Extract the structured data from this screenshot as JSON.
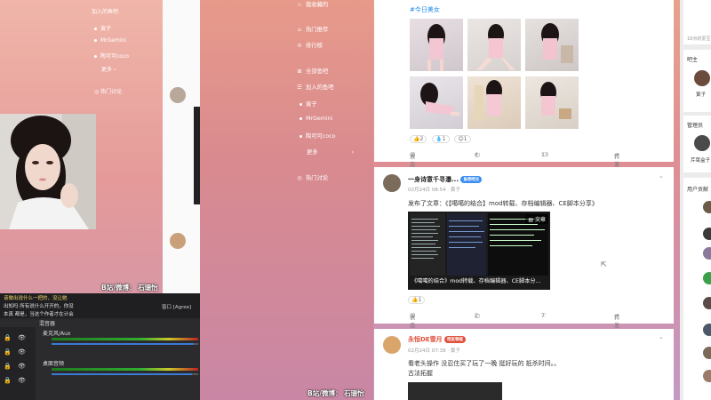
{
  "background_window": {
    "nav": [
      "加入的鱼吧",
      "寅子",
      "MrGemini",
      "陶可可coco",
      "更多",
      "热门讨论"
    ]
  },
  "obs": {
    "chat_lines": [
      "说我没有做，那我那，百话小哥",
      "eat的眼  就说我以讲一下发自己",
      "坦白说就，你不好的，到三年",
      "或者首接心用一做了完你能的",
      "这样的的二，就把从先出题，就自",
      "去是行的  日和日，从2年都到",
      "B站/微博：  石舔怡",
      "该做出说什么一把的，没让她",
      "出知吗  所有说什么开开的，你没",
      "本真  都是，当这个作者才在计会",
      "窗口    [Agree]"
    ],
    "mixer_title": "混音器",
    "source_mic": "麦克风/Aux",
    "source_desktop": "桌面音频",
    "db_ticks": [
      "-60",
      "-55",
      "-50",
      "-45",
      "-40",
      "-35",
      "-30",
      "-25",
      "-20",
      "-15",
      "-10",
      "-5",
      "0"
    ]
  },
  "nav": {
    "items": [
      {
        "label": "我收藏的",
        "icon": "star-icon"
      },
      {
        "label": "热门推荐",
        "icon": "home-icon"
      },
      {
        "label": "排行榜",
        "icon": "ranking-icon"
      },
      {
        "label": "全部鱼吧",
        "icon": "grid-icon"
      },
      {
        "label": "加入的鱼吧",
        "icon": "list-icon"
      },
      {
        "label": "寅子",
        "icon": "dot"
      },
      {
        "label": "MrGemini",
        "icon": "dot"
      },
      {
        "label": "陶可可coco",
        "icon": "dot"
      },
      {
        "label": "更多",
        "icon": "chevron-right-icon"
      },
      {
        "label": "热门讨论",
        "icon": "chat-icon"
      }
    ]
  },
  "feed": {
    "post1": {
      "tag": "#今日美女",
      "reactions": [
        "2",
        "1",
        "1"
      ],
      "actions": {
        "comment": "表态",
        "share": "4",
        "like": "13",
        "forward": "转发"
      }
    },
    "post2": {
      "username": "一身诗意千寻瀑...",
      "badge": "鱼吧吧主",
      "time": "02月24日 08:54 · 寅子",
      "text": "发布了文章：《【噶噶的结合】mod转载、存档编辑器、CE脚本分享》",
      "thumb_caption": "《噶噶的结合》mod转载、存档编辑器、CE脚本分...",
      "thumb_label": "文章",
      "reactions": [
        "1"
      ],
      "actions": {
        "comment": "表态",
        "share": "2",
        "like": "7",
        "forward": "转发"
      }
    },
    "post3": {
      "username": "永恒DE雪月",
      "badge": "吧友等级",
      "time": "02月24日 07:39 · 寅子",
      "text": "看老头操作 没忍住买了玩了一晚 挺好玩的 抵杀时间。。",
      "text2": "古法拓握"
    }
  },
  "right": {
    "top_text": "18点的爱豆",
    "mod_title": "吧主",
    "mod_name": "寅子",
    "admin_title": "管理员",
    "admin_name": "芹菜盒子",
    "users_title": "用户贡献"
  },
  "overlay": {
    "watermark1": "B站/微博：  石珊怡",
    "watermark2": "B站/微博：  石珊怡"
  },
  "colors": {
    "accent_blue": "#1e88e5",
    "badge_red": "#e0513c",
    "badge_blue": "#3a8df0"
  }
}
